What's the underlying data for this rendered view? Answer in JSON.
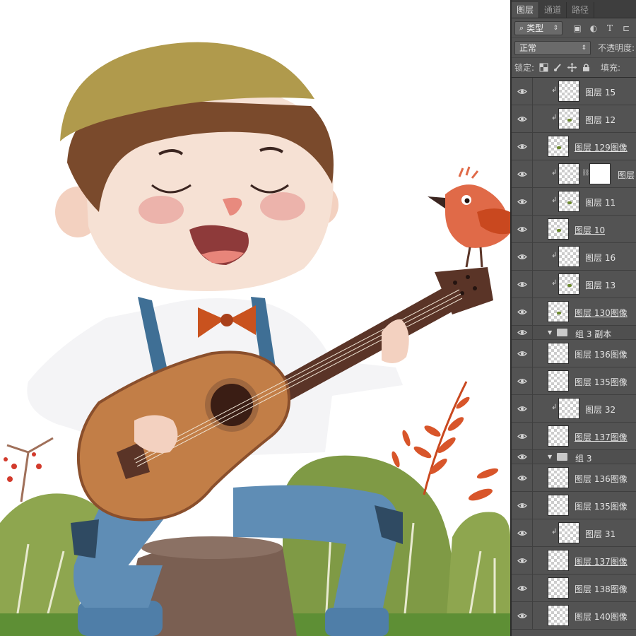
{
  "panel": {
    "tabs": [
      {
        "label": "图层"
      },
      {
        "label": "通道"
      },
      {
        "label": "路径"
      }
    ],
    "filter": {
      "label": "类型",
      "icons": [
        "search-icon",
        "image-filter-icon",
        "adjustment-filter-icon",
        "text-filter-icon",
        "shape-filter-icon"
      ]
    },
    "blend": {
      "mode": "正常",
      "opacity_label": "不透明度:"
    },
    "lock": {
      "label": "锁定:",
      "fill_label": "填充:",
      "icons": [
        "lock-transparent-icon",
        "lock-paint-icon",
        "lock-position-icon",
        "lock-all-icon"
      ]
    },
    "layers": [
      {
        "name": "图层 15",
        "clipped": true,
        "underline": false,
        "speck": false
      },
      {
        "name": "图层 12",
        "clipped": true,
        "underline": false,
        "speck": true
      },
      {
        "name": "图层 129图像",
        "clipped": false,
        "underline": true,
        "speck": true
      },
      {
        "name": "图层",
        "clipped": true,
        "underline": false,
        "speck": false,
        "mask": true
      },
      {
        "name": "图层 11",
        "clipped": true,
        "underline": false,
        "speck": true
      },
      {
        "name": "图层 10",
        "clipped": false,
        "underline": true,
        "speck": true
      },
      {
        "name": "图层 16",
        "clipped": true,
        "underline": false,
        "speck": false
      },
      {
        "name": "图层 13",
        "clipped": true,
        "underline": false,
        "speck": true
      },
      {
        "name": "图层 130图像",
        "clipped": false,
        "underline": true,
        "speck": true
      },
      {
        "group": true,
        "name": "组 3 副本"
      },
      {
        "name": "图层 136图像",
        "clipped": false,
        "underline": false,
        "speck": false
      },
      {
        "name": "图层 135图像",
        "clipped": false,
        "underline": false,
        "speck": false
      },
      {
        "name": "图层 32",
        "clipped": true,
        "underline": false,
        "speck": false
      },
      {
        "name": "图层 137图像",
        "clipped": false,
        "underline": true,
        "speck": false
      },
      {
        "group": true,
        "name": "组 3"
      },
      {
        "name": "图层 136图像",
        "clipped": false,
        "underline": false,
        "speck": false
      },
      {
        "name": "图层 135图像",
        "clipped": false,
        "underline": false,
        "speck": false
      },
      {
        "name": "图层 31",
        "clipped": true,
        "underline": false,
        "speck": false
      },
      {
        "name": "图层 137图像",
        "clipped": false,
        "underline": true,
        "speck": false
      },
      {
        "name": "图层 138图像",
        "clipped": false,
        "underline": false,
        "speck": false
      },
      {
        "name": "图层 140图像",
        "clipped": false,
        "underline": false,
        "speck": false
      }
    ]
  },
  "colors": {
    "panel_bg": "#535353",
    "hat": "#b09a4c",
    "hair": "#7a4a2c",
    "skin": "#f6e1d4",
    "cheek": "#e8a09a",
    "shirt": "#f4f4f6",
    "suspender": "#3f6f95",
    "bow": "#c9521e",
    "guitar_body": "#c27e47",
    "guitar_neck": "#5a3427",
    "jeans": "#5f8db5",
    "stump": "#7a5f52",
    "bush": "#7f9a45",
    "leaf": "#d8552a",
    "bird": "#e06a48"
  }
}
